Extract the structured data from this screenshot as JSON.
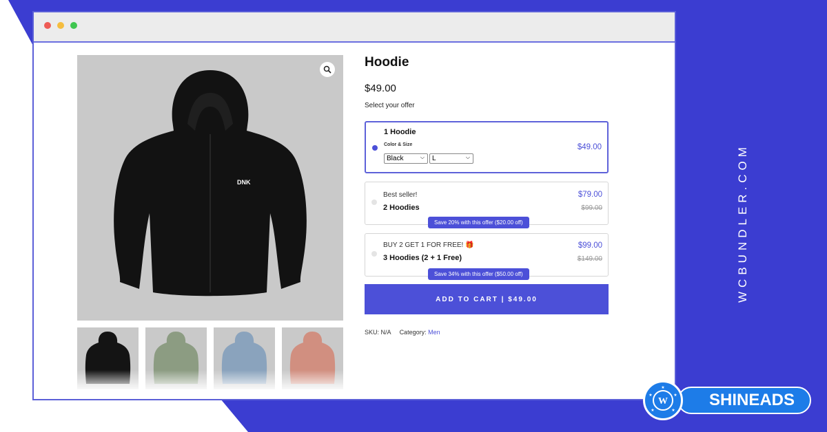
{
  "colors": {
    "accent": "#4c50d8",
    "background": "#3b3dd1",
    "logo_blue": "#1d7ce8"
  },
  "window": {
    "controls": [
      "close-dot",
      "minimize-dot",
      "maximize-dot"
    ]
  },
  "product": {
    "title": "Hoodie",
    "price": "$49.00",
    "select_label": "Select your offer",
    "image_icon": "zoom-icon",
    "logo_text": "DNK",
    "thumbnails": [
      {
        "color": "#141414"
      },
      {
        "color": "#8c9c82"
      },
      {
        "color": "#8aa3bd"
      },
      {
        "color": "#d18f80"
      }
    ]
  },
  "offers": [
    {
      "title": "1 Hoodie",
      "price": "$49.00",
      "variant_label": "Color & Size",
      "color_value": "Black",
      "size_value": "L",
      "selected": true
    },
    {
      "sub": "Best seller!",
      "title": "2 Hoodies",
      "price": "$79.00",
      "old_price": "$99.00",
      "save_text": "Save 20% with this offer ($20.00 off)",
      "selected": false
    },
    {
      "sub": "BUY 2 GET 1 FOR FREE! 🎁",
      "title": "3 Hoodies (2 + 1 Free)",
      "price": "$99.00",
      "old_price": "$149.00",
      "save_text": "Save 34% with this offer ($50.00 off)",
      "selected": false
    }
  ],
  "cart": {
    "label": "ADD TO CART | $49.00"
  },
  "meta": {
    "sku_label": "SKU:",
    "sku_value": "N/A",
    "category_label": "Category:",
    "category_value": "Men"
  },
  "branding": {
    "vertical_text": "WCBUNDLER.COM",
    "logo_text": "SHINEADS"
  }
}
